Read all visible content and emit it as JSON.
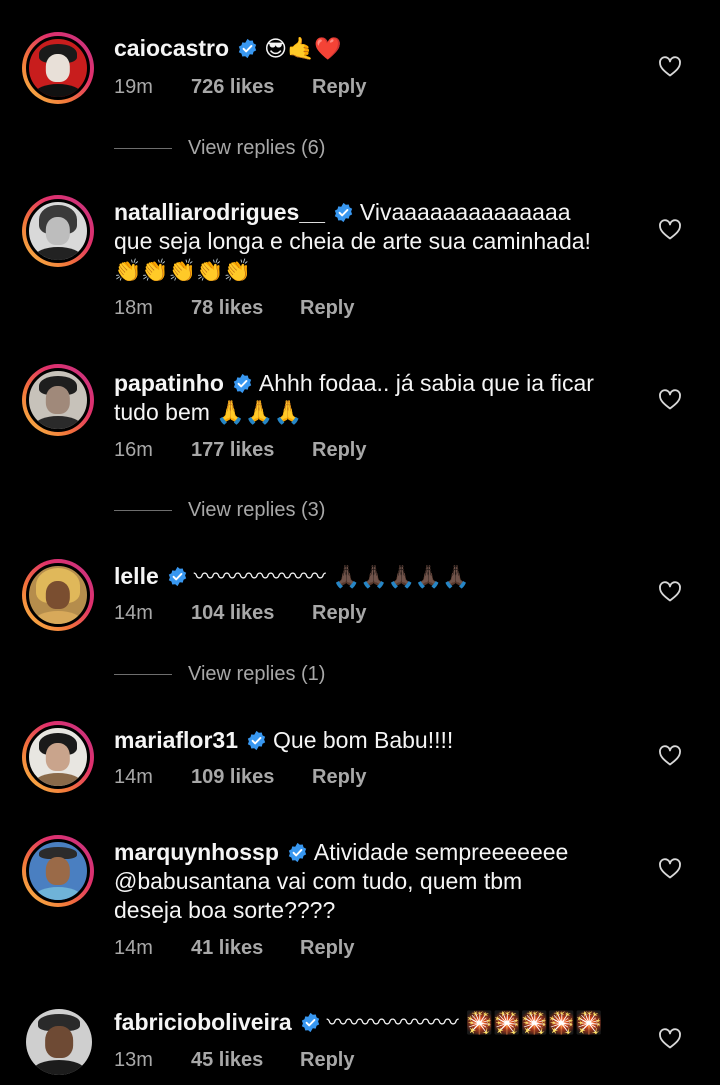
{
  "comments": [
    {
      "username": "caiocastro",
      "line1": "",
      "emoji_after_name": "😎🤙❤️",
      "time": "19m",
      "likes": "726 likes",
      "reply": "Reply",
      "view_replies": "View replies (6)"
    },
    {
      "username": "natalliarodrigues__",
      "line1": "Vivaaaaaaaaaaaaaa",
      "line2": "que seja longa e cheia de arte sua caminhada!",
      "line3": "👏👏👏👏👏",
      "time": "18m",
      "likes": "78 likes",
      "reply": "Reply"
    },
    {
      "username": "papatinho",
      "line1": "Ahhh fodaa.. já sabia que ia ficar",
      "line2": "tudo bem 🙏🙏🙏",
      "time": "16m",
      "likes": "177 likes",
      "reply": "Reply",
      "view_replies": "View replies (3)"
    },
    {
      "username": "lelle",
      "line1": "〰〰〰〰〰〰 🙏🏿🙏🏿🙏🏿🙏🏿🙏🏿",
      "time": "14m",
      "likes": "104 likes",
      "reply": "Reply",
      "view_replies": "View replies (1)"
    },
    {
      "username": "mariaflor31",
      "line1": "Que bom Babu!!!!",
      "time": "14m",
      "likes": "109 likes",
      "reply": "Reply"
    },
    {
      "username": "marquynhossp",
      "line1": "Atividade sempreeeeeee",
      "line2": "@babusantana  vai com tudo, quem tbm",
      "line3": "deseja boa sorte????",
      "time": "14m",
      "likes": "41 likes",
      "reply": "Reply"
    },
    {
      "username": "fabricioboliveira",
      "line1": "〰〰〰〰〰〰 🎇🎇🎇🎇🎇",
      "time": "13m",
      "likes": "45 likes",
      "reply": "Reply"
    }
  ],
  "icons": {
    "verified": "verified-badge-icon",
    "like": "heart-icon"
  },
  "colors": {
    "background": "#000000",
    "text": "#f5f5f5",
    "secondary": "#a8a8a8",
    "verified": "#3897f0"
  }
}
